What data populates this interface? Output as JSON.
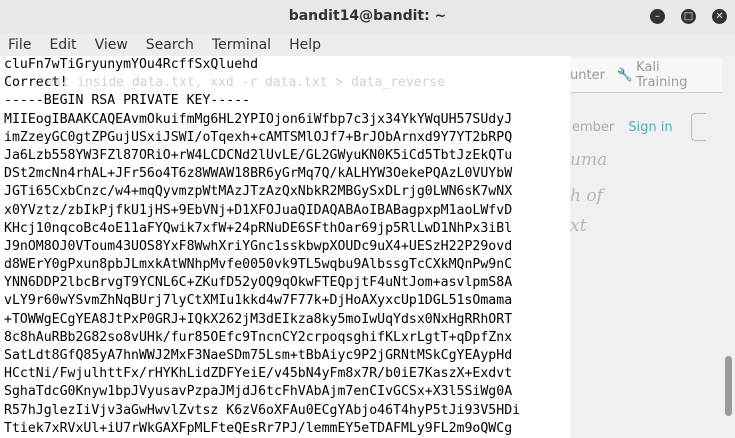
{
  "window": {
    "title": "bandit14@bandit: ~",
    "minimize_glyph": "–",
    "maximize_glyph": "□",
    "close_glyph": "✕"
  },
  "menu": [
    "File",
    "Edit",
    "View",
    "Search",
    "Terminal",
    "Help"
  ],
  "background_app": {
    "bookmark1": "unter",
    "bookmark2": "Kali Training",
    "member": "ember",
    "signin": "Sign in",
    "ghost_text": [
      "uma",
      "h of",
      "xt"
    ]
  },
  "terminal": {
    "lines": [
      "cluFn7wTiGryunymYOu4RcffSxQluehd",
      "Correct!",
      "-----BEGIN RSA PRIVATE KEY-----",
      "MIIEogIBAAKCAQEAvmOkuifmMg6HL2YPIOjon6iWfbp7c3jx34YkYWqUH57SUdyJ",
      "imZzeyGC0gtZPGujUSxiJSWI/oTqexh+cAMTSMlOJf7+BrJObArnxd9Y7YT2bRPQ",
      "Ja6Lzb558YW3FZl87ORiO+rW4LCDCNd2lUvLE/GL2GWyuKN0K5iCd5TbtJzEkQTu",
      "DSt2mcNn4rhAL+JFr56o4T6z8WWAW18BR6yGrMq7Q/kALHYW3OekePQAzL0VUYbW",
      "JGTi65CxbCnzc/w4+mqQyvmzpWtMAzJTzAzQxNbkR2MBGySxDLrjg0LWN6sK7wNX",
      "x0YVztz/zbIkPjfkU1jHS+9EbVNj+D1XFOJuaQIDAQABAoIBABagpxpM1aoLWfvD",
      "KHcj10nqcoBc4oE11aFYQwik7xfW+24pRNuDE6SFthOar69jp5RlLwD1NhPx3iBl",
      "J9nOM8OJ0VToum43UOS8YxF8WwhXriYGnc1sskbwpXOUDc9uX4+UESzH22P29ovd",
      "d8WErY0gPxun8pbJLmxkAtWNhpMvfe0050vk9TL5wqbu9AlbssgTcCXkMQnPw9nC",
      "YNN6DDP2lbcBrvgT9YCNL6C+ZKufD52yOQ9qOkwFTEQpjtF4uNtJom+asvlpmS8A",
      "vLY9r60wYSvmZhNqBUrj7lyCtXMIu1kkd4w7F77k+DjHoAXyxcUp1DGL51sOmama",
      "+TOWWgECgYEA8JtPxP0GRJ+IQkX262jM3dEIkza8ky5moIwUqYdsx0NxHgRRhORT",
      "8c8hAuRBb2G82so8vUHk/fur85OEfc9TncnCY2crpoqsghifKLxrLgtT+qDpfZnx",
      "SatLdt8GfQ85yA7hnWWJ2MxF3NaeSDm75Lsm+tBbAiyc9P2jGRNtMSkCgYEAypHd",
      "HCctNi/FwjulhttFx/rHYKhLidZDFYeiE/v45bN4yFm8x7R/b0iE7KaszX+Exdvt",
      "SghaTdcG0Knyw1bpJVyusavPzpaJMjdJ6tcFhVAbAjm7enCIvGCSx+X3l5SiWg0A",
      "R57hJglezIiVjv3aGwHwvlZvtsz K6zV6oXFAu0ECgYAbjo46T4hyP5tJi93V5HDi",
      "Ttiek7xRVxUl+iU7rWkGAXFpMLFteQEsRr7PJ/lemmEY5eTDAFMLy9FL2m9oQWCg"
    ],
    "ghost_line": "text inside data.txt, xxd -r data.txt > data_reverse"
  }
}
